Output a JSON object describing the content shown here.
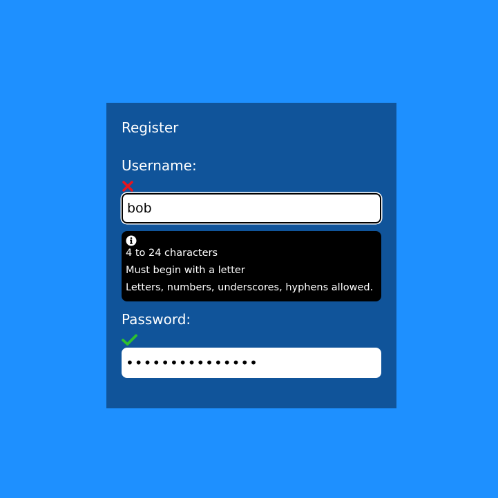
{
  "form": {
    "title": "Register",
    "username": {
      "label": "Username:",
      "value": "bob",
      "valid": false,
      "status_icon": "cross-icon",
      "status_color": "#e8141e"
    },
    "hint": {
      "icon": "info-icon",
      "rules": [
        "4 to 24 characters",
        "Must begin with a letter",
        "Letters, numbers, underscores, hyphens allowed."
      ]
    },
    "password": {
      "label": "Password:",
      "value": "•••••••••••••••",
      "valid": true,
      "status_icon": "check-icon",
      "status_color": "#2ec02e"
    }
  },
  "colors": {
    "page_background": "#1e90ff",
    "panel_background": "#10549a",
    "tooltip_background": "#000000"
  }
}
